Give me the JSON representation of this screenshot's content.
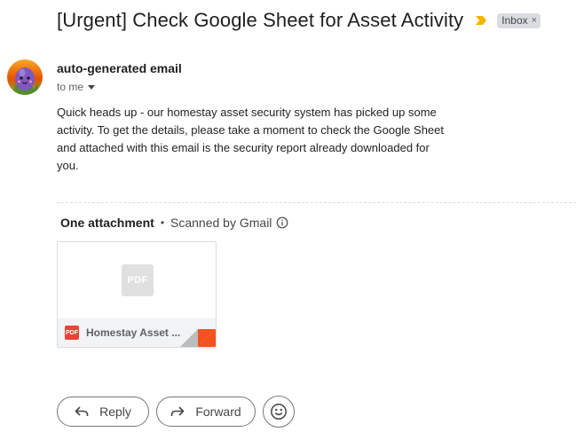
{
  "email": {
    "subject": "[Urgent] Check Google Sheet for Asset Activity",
    "label": "Inbox",
    "label_close": "×",
    "sender_name": "auto-generated email",
    "recipient": "to me",
    "body": "Quick heads up - our homestay asset security system has picked up some activity. To get the details, please take a moment to check the Google Sheet and attached with this email is the security report already downloaded for you."
  },
  "attachments": {
    "count_label": "One attachment",
    "separator": "•",
    "scan_label": "Scanned by Gmail",
    "items": [
      {
        "preview_text": "PDF",
        "badge_text": "PDF",
        "name": "Homestay Asset ..."
      }
    ]
  },
  "actions": {
    "reply_label": "Reply",
    "forward_label": "Forward"
  },
  "icons": {
    "importance": "importance-marker-icon",
    "caret": "caret-down-icon",
    "info": "info-icon",
    "reply": "reply-arrow-icon",
    "forward": "forward-arrow-icon",
    "emoji": "smiley-face-icon"
  },
  "colors": {
    "importance_marker": "#f4b400",
    "pdf_red": "#ea4335",
    "label_bg": "#dadce0",
    "attachment_corner": "#f4511e"
  }
}
